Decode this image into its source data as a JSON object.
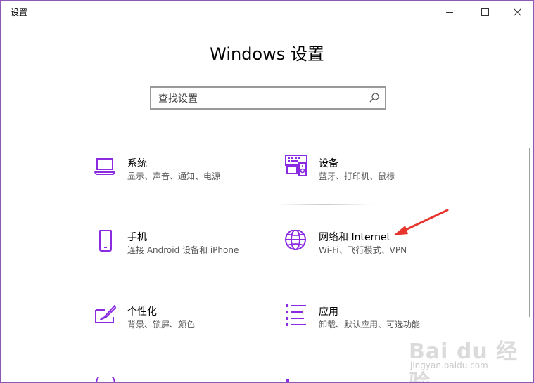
{
  "window": {
    "title": "设置"
  },
  "page": {
    "title": "Windows 设置"
  },
  "search": {
    "placeholder": "查找设置"
  },
  "tiles": [
    {
      "name": "系统",
      "desc": "显示、声音、通知、电源",
      "icon": "laptop-icon"
    },
    {
      "name": "设备",
      "desc": "蓝牙、打印机、鼠标",
      "icon": "keyboard-printer-icon"
    },
    {
      "name": "手机",
      "desc": "连接 Android 设备和 iPhone",
      "icon": "phone-icon"
    },
    {
      "name": "网络和 Internet",
      "desc": "Wi-Fi、飞行模式、VPN",
      "icon": "globe-icon"
    },
    {
      "name": "个性化",
      "desc": "背景、锁屏、颜色",
      "icon": "paint-brush-icon"
    },
    {
      "name": "应用",
      "desc": "卸载、默认应用、可选功能",
      "icon": "apps-list-icon"
    }
  ],
  "colors": {
    "accent": "#8a2be2",
    "annotation": "#e8352e"
  },
  "watermark": {
    "text": "Bai du 经验",
    "url": "jingyan.baidu.com"
  }
}
